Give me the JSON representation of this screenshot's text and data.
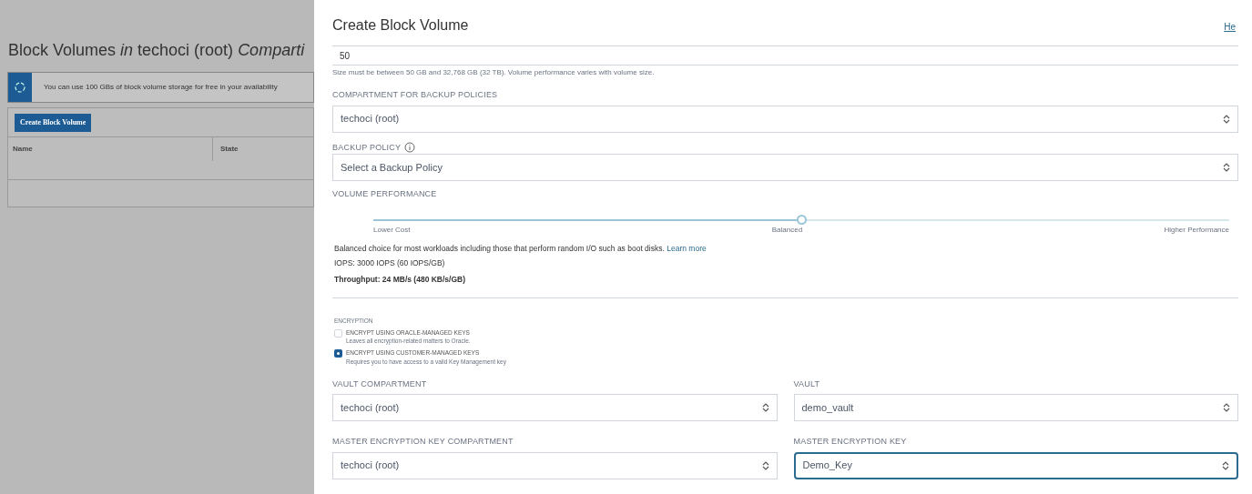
{
  "background_page": {
    "title": "Block Volumes *in* techoci (root) *Comparti*",
    "notice": "You can use 100 GBs of block volume storage for free in your availability",
    "create_button": "Create Block Volume",
    "table": {
      "columns": [
        "Name",
        "State"
      ]
    }
  },
  "dialog": {
    "title": "Create Block Volume",
    "help_link": "He",
    "size": {
      "value": "50",
      "helper": "Size must be between 50 GB and 32,768 GB (32 TB). Volume performance varies with volume size."
    },
    "backup_compartment": {
      "label": "COMPARTMENT FOR BACKUP POLICIES",
      "value": "techoci (root)"
    },
    "backup_policy": {
      "label": "BACKUP POLICY",
      "value": "Select a Backup Policy"
    },
    "performance": {
      "label": "VOLUME PERFORMANCE",
      "level": 0.5,
      "stops": [
        "Lower Cost",
        "Balanced",
        "Higher Performance"
      ],
      "description": "Balanced choice for most workloads including those that perform random I/O such as boot disks.",
      "learn_more": "Learn more",
      "iops": "IOPS: 3000 IOPS (60 IOPS/GB)",
      "throughput": "Throughput: 24 MB/s (480 KB/s/GB)"
    },
    "encryption": {
      "label": "ENCRYPTION",
      "options": [
        {
          "title": "ENCRYPT USING ORACLE-MANAGED KEYS",
          "description": "Leaves all encryption-related matters to Oracle.",
          "selected": false
        },
        {
          "title": "ENCRYPT USING CUSTOMER-MANAGED KEYS",
          "description": "Requires you to have access to a valid Key Management key",
          "selected": true
        }
      ]
    },
    "key_fields": [
      {
        "label": "VAULT COMPARTMENT",
        "value": "techoci (root)",
        "focused": false
      },
      {
        "label": "VAULT",
        "value": "demo_vault",
        "focused": false
      },
      {
        "label": "MASTER ENCRYPTION KEY COMPARTMENT",
        "value": "techoci (root)",
        "focused": false
      },
      {
        "label": "MASTER ENCRYPTION KEY",
        "value": "Demo_Key",
        "focused": true
      }
    ]
  }
}
